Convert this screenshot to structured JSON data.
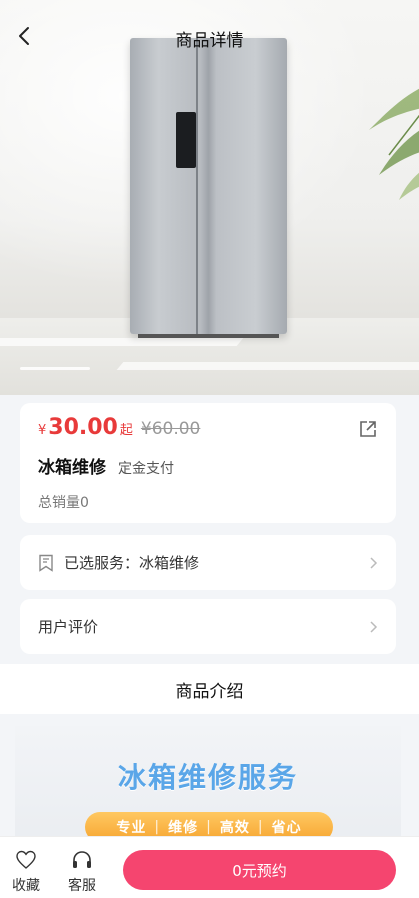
{
  "header": {
    "title": "商品详情"
  },
  "product": {
    "currency_symbol": "¥",
    "price": "30.00",
    "price_suffix": "起",
    "original_price": "¥60.00",
    "name": "冰箱维修",
    "payment_type": "定金支付",
    "sales": "总销量0"
  },
  "service_row": {
    "label": "已选服务：冰箱维修"
  },
  "review_row": {
    "label": "用户评价"
  },
  "intro": {
    "title": "商品介绍"
  },
  "banner": {
    "title": "冰箱维修服务",
    "tags": [
      "专业",
      "维修",
      "高效",
      "省心"
    ]
  },
  "bottom_bar": {
    "favorite_label": "收藏",
    "service_label": "客服",
    "book_label": "0元预约"
  },
  "colors": {
    "price": "#e83a3a",
    "book_button": "#f5456f",
    "banner_title": "#5aa6e8",
    "banner_pill": "#f6a531"
  }
}
